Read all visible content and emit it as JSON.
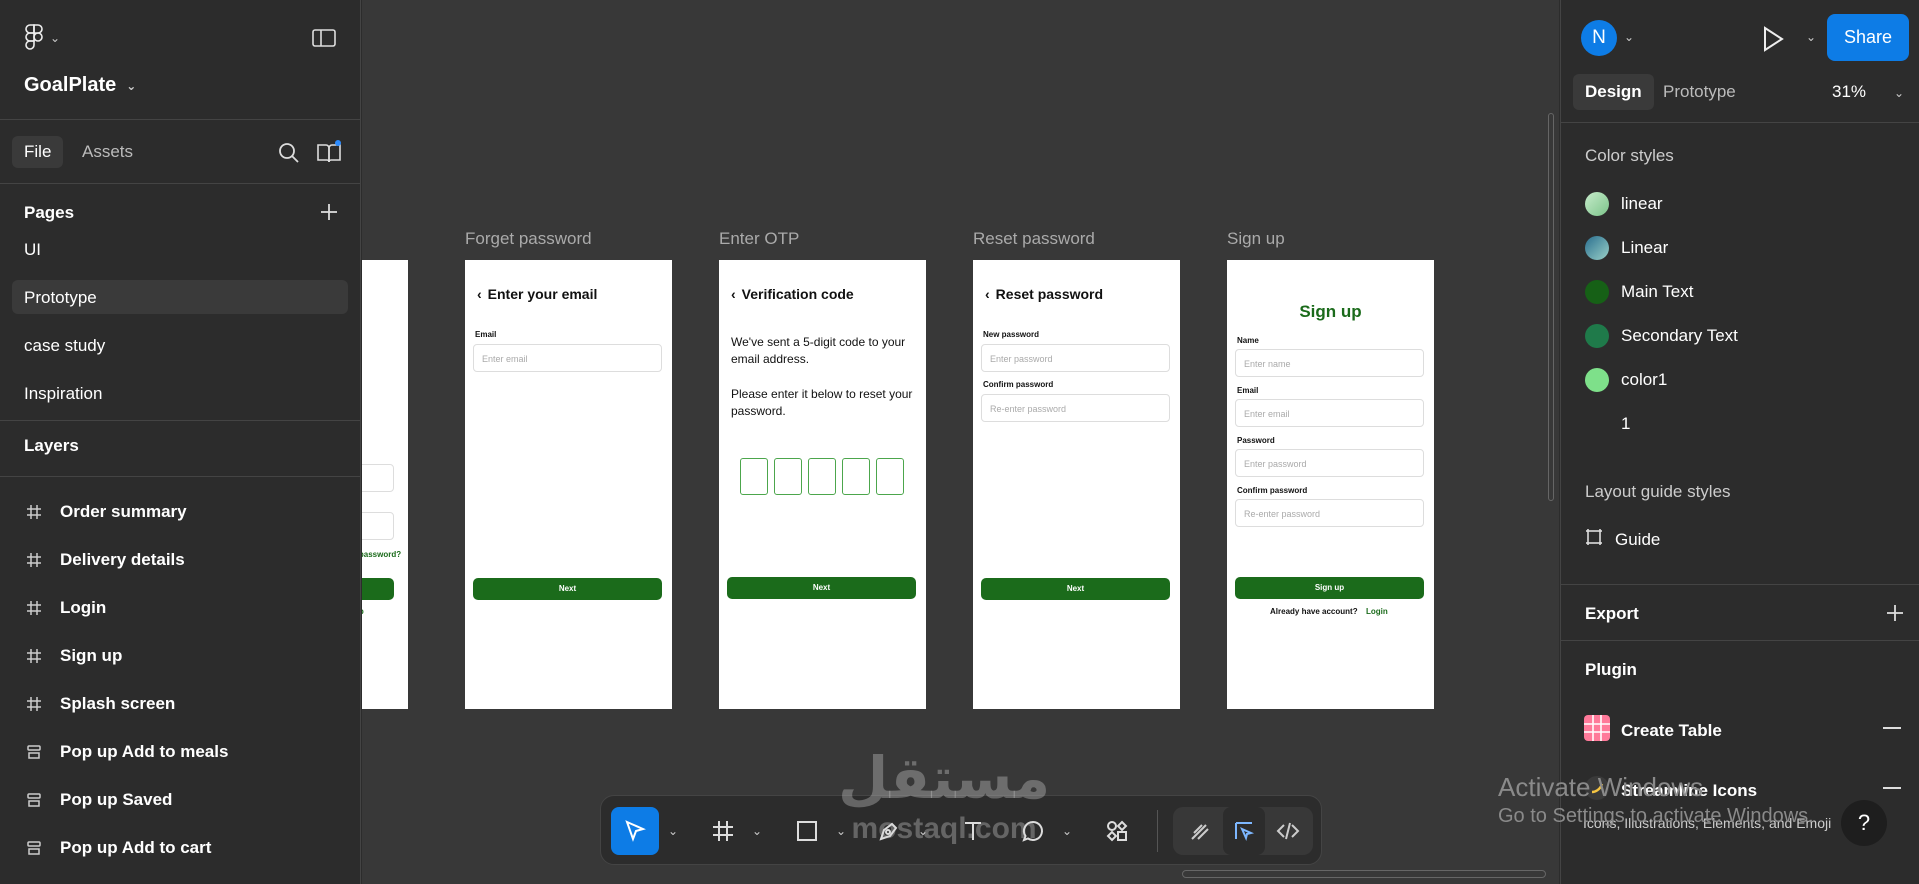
{
  "app": {
    "project_name": "GoalPlate"
  },
  "left_panel": {
    "tabs": [
      {
        "label": "File",
        "active": true
      },
      {
        "label": "Assets",
        "active": false
      }
    ],
    "pages_heading": "Pages",
    "pages": [
      {
        "label": "UI",
        "active": false
      },
      {
        "label": "Prototype",
        "active": true
      },
      {
        "label": "case study",
        "active": false
      },
      {
        "label": "Inspiration",
        "active": false
      }
    ],
    "layers_heading": "Layers",
    "layers": [
      {
        "label": "Order summary",
        "icon": "frame-icon"
      },
      {
        "label": "Delivery details",
        "icon": "frame-icon"
      },
      {
        "label": "Login",
        "icon": "frame-icon"
      },
      {
        "label": "Sign up",
        "icon": "frame-icon"
      },
      {
        "label": "Splash screen",
        "icon": "frame-icon"
      },
      {
        "label": "Pop up Add to meals",
        "icon": "section-icon"
      },
      {
        "label": "Pop up Saved",
        "icon": "section-icon"
      },
      {
        "label": "Pop up Add to cart",
        "icon": "section-icon"
      }
    ]
  },
  "canvas": {
    "partial_frame": {
      "link_text": "t password?",
      "small_text": "up"
    },
    "frames": [
      {
        "label": "Forget password",
        "title": "Enter your email",
        "email_label": "Email",
        "email_placeholder": "Enter email",
        "button": "Next"
      },
      {
        "label": "Enter OTP",
        "title": "Verification code",
        "text1": "We've sent a 5-digit code to your email address.",
        "text2": "Please enter it below to reset your password.",
        "otp_boxes": 5,
        "button": "Next"
      },
      {
        "label": "Reset password",
        "title": "Reset password",
        "new_password_label": "New password",
        "new_password_placeholder": "Enter password",
        "confirm_label": "Confirm password",
        "confirm_placeholder": "Re-enter password",
        "button": "Next"
      },
      {
        "label": "Sign up",
        "title": "Sign up",
        "name_label": "Name",
        "name_placeholder": "Enter name",
        "email_label": "Email",
        "email_placeholder": "Enter email",
        "password_label": "Password",
        "password_placeholder": "Enter password",
        "confirm_label": "Confirm password",
        "confirm_placeholder": "Re-enter password",
        "button": "Sign up",
        "footer_text": "Already have account?",
        "footer_link": "Login"
      }
    ]
  },
  "toolbar": {
    "tools": [
      "move-tool",
      "frame-tool",
      "rectangle-tool",
      "pen-tool",
      "text-tool",
      "comment-tool",
      "actions-tool",
      "draw-mode",
      "design-mode",
      "dev-mode"
    ]
  },
  "right_panel": {
    "avatar_initial": "N",
    "share_label": "Share",
    "tabs": [
      {
        "label": "Design",
        "active": true
      },
      {
        "label": "Prototype",
        "active": false
      }
    ],
    "zoom": "31%",
    "color_styles_heading": "Color styles",
    "color_styles": [
      {
        "name": "linear",
        "color": "#a8dcb0"
      },
      {
        "name": "Linear",
        "color": "#4f8fa8"
      },
      {
        "name": "Main Text",
        "color": "#166016"
      },
      {
        "name": "Secondary Text",
        "color": "#1f7a4a"
      },
      {
        "name": "color1",
        "color": "#7ee08a"
      },
      {
        "name": "1",
        "color": ""
      }
    ],
    "layout_guide_heading": "Layout guide styles",
    "layout_guide_item": "Guide",
    "export_heading": "Export",
    "plugin_heading": "Plugin",
    "plugins": [
      {
        "name": "Create Table"
      },
      {
        "name": "Streamline Icons"
      }
    ],
    "plugin_subtext": "Icons, Illustrations, Elements, and Emoji"
  },
  "overlays": {
    "activate_title": "Activate Windows",
    "activate_sub": "Go to Settings to activate Windows.",
    "watermark_arabic": "مستقل",
    "watermark_latin": "mostaql.com"
  }
}
